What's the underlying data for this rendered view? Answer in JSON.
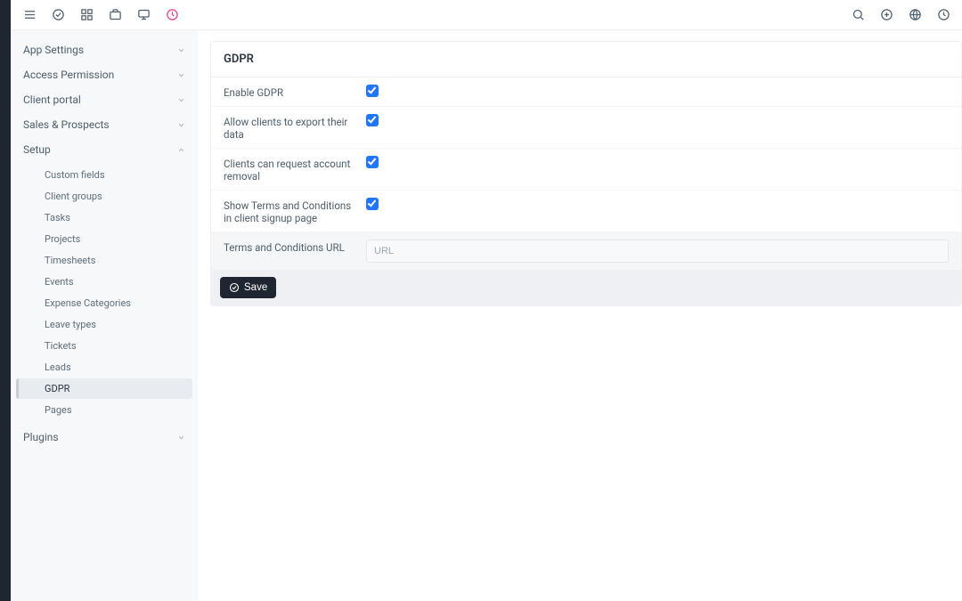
{
  "topbar": {
    "left_icons": [
      "menu-icon",
      "check-circle-icon",
      "grid-icon",
      "briefcase-icon",
      "monitor-icon",
      "clock-accent-icon"
    ],
    "right_icons": [
      "search-icon",
      "plus-circle-icon",
      "globe-icon",
      "clock-icon"
    ]
  },
  "sidebar": {
    "sections": [
      {
        "label": "App Settings",
        "expanded": false
      },
      {
        "label": "Access Permission",
        "expanded": false
      },
      {
        "label": "Client portal",
        "expanded": false
      },
      {
        "label": "Sales & Prospects",
        "expanded": false
      },
      {
        "label": "Setup",
        "expanded": true,
        "items": [
          {
            "label": "Custom fields"
          },
          {
            "label": "Client groups"
          },
          {
            "label": "Tasks"
          },
          {
            "label": "Projects"
          },
          {
            "label": "Timesheets"
          },
          {
            "label": "Events"
          },
          {
            "label": "Expense Categories"
          },
          {
            "label": "Leave types"
          },
          {
            "label": "Tickets"
          },
          {
            "label": "Leads"
          },
          {
            "label": "GDPR",
            "active": true
          },
          {
            "label": "Pages"
          }
        ]
      },
      {
        "label": "Plugins",
        "expanded": false
      }
    ]
  },
  "page": {
    "title": "GDPR",
    "rows": {
      "enable_gdpr": {
        "label": "Enable GDPR",
        "checked": true
      },
      "allow_export": {
        "label": "Allow clients to export their data",
        "checked": true
      },
      "request_removal": {
        "label": "Clients can request account removal",
        "checked": true
      },
      "show_terms": {
        "label": "Show Terms and Conditions in client signup page",
        "checked": true
      },
      "terms_url": {
        "label": "Terms and Conditions URL",
        "placeholder": "URL",
        "value": ""
      }
    },
    "save_label": "Save"
  }
}
